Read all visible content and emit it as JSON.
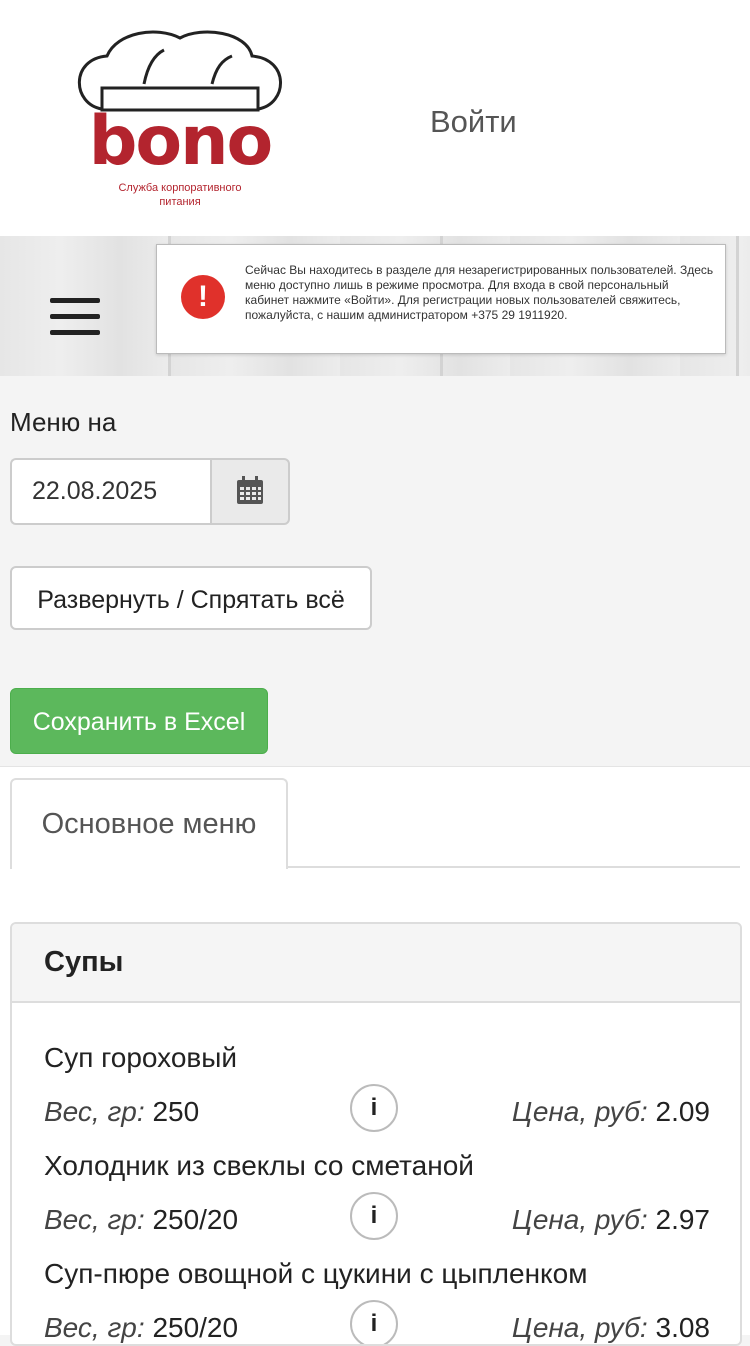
{
  "header": {
    "logo_text": "bono",
    "logo_subtitle_line1": "Служба корпоративного",
    "logo_subtitle_line2": "питания",
    "login_label": "Войти"
  },
  "notice": {
    "icon": "exclamation-icon",
    "text": "Сейчас Вы находитесь в разделе для незарегистрированных пользователей. Здесь меню доступно лишь в режиме просмотра. Для входа в свой персональный кабинет нажмите «Войти». Для регистрации новых пользователей свяжитесь, пожалуйста, с нашим администратором +375 29 1911920."
  },
  "menu_date": {
    "label": "Меню на",
    "value": "22.08.2025",
    "icon": "calendar-icon"
  },
  "buttons": {
    "toggle_all": "Развернуть / Спрятать всё",
    "save_excel": "Сохранить в Excel"
  },
  "tabs": [
    {
      "label": "Основное меню",
      "active": true
    }
  ],
  "section": {
    "title": "Супы",
    "weight_label": "Вес, гр:",
    "price_label": "Цена, руб:",
    "info_label": "i",
    "dishes": [
      {
        "name": "Суп гороховый",
        "weight": "250",
        "price": "2.09"
      },
      {
        "name": "Холодник из свеклы со сметаной",
        "weight": "250/20",
        "price": "2.97"
      },
      {
        "name": "Суп-пюре овощной с цукини с цыпленком",
        "weight": "250/20",
        "price": "3.08"
      }
    ]
  },
  "colors": {
    "brand_red": "#b3242e",
    "excel_green": "#5cb85c",
    "alert_red": "#e0312b"
  }
}
